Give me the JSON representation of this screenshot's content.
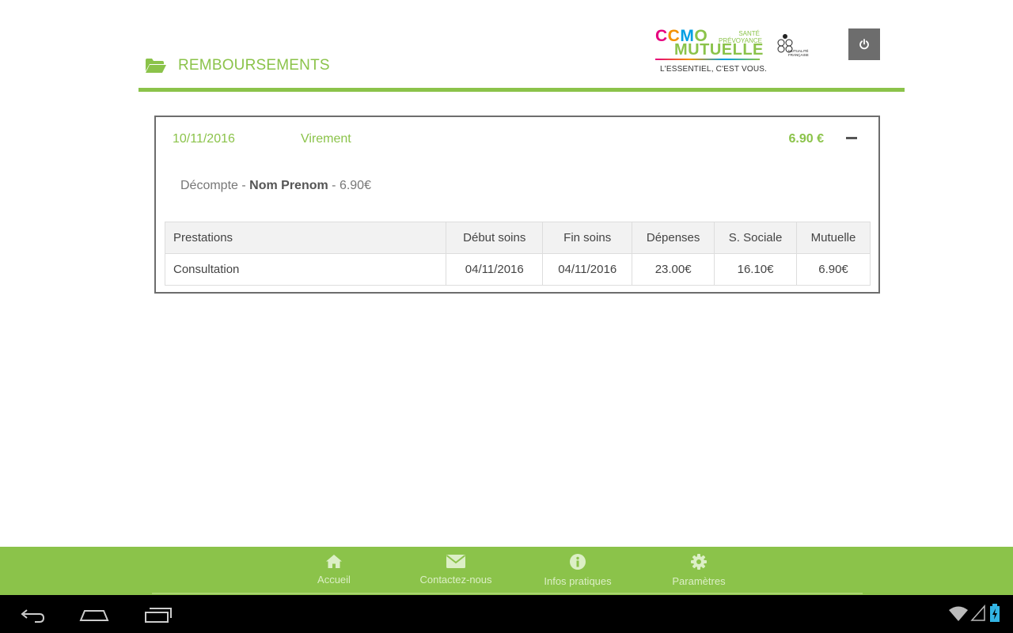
{
  "header": {
    "title": "REMBOURSEMENTS"
  },
  "logo": {
    "ccmo": [
      "C",
      "C",
      "M",
      "O"
    ],
    "sante": "SANTÉ",
    "prevoyance": "PRÉVOYANCE",
    "mutuelle": "MUTUELLE",
    "tagline": "L'ESSENTIEL, C'EST VOUS.",
    "mutualite": [
      "MUTUALITÉ",
      "FRANÇAISE"
    ]
  },
  "colors": {
    "accent": "#8bc34a",
    "border": "#6d6d6d"
  },
  "reimbursement": {
    "date": "10/11/2016",
    "method": "Virement",
    "amount": "6.90 €",
    "decompte_prefix": "Décompte - ",
    "beneficiary": "Nom Prenom",
    "decompte_suffix": " - 6.90€",
    "table": {
      "headers": [
        "Prestations",
        "Début soins",
        "Fin soins",
        "Dépenses",
        "S. Sociale",
        "Mutuelle"
      ],
      "rows": [
        [
          "Consultation",
          "04/11/2016",
          "04/11/2016",
          "23.00€",
          "16.10€",
          "6.90€"
        ]
      ]
    }
  },
  "nav": {
    "items": [
      {
        "label": "Accueil",
        "icon": "home-icon"
      },
      {
        "label": "Contactez-nous",
        "icon": "envelope-icon"
      },
      {
        "label": "Infos pratiques",
        "icon": "info-icon"
      },
      {
        "label": "Paramètres",
        "icon": "gear-icon"
      }
    ]
  }
}
